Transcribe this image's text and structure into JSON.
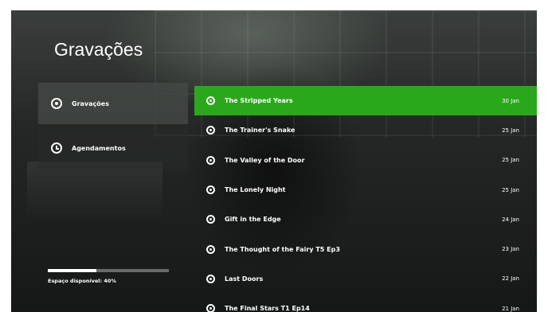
{
  "header": {
    "title": "Gravações"
  },
  "sidebar": {
    "items": [
      {
        "label": "Gravações",
        "icon": "radio-selected-icon",
        "active": true
      },
      {
        "label": "Agendamentos",
        "icon": "clock-icon",
        "active": false
      }
    ]
  },
  "storage": {
    "label": "Espaço disponível: 40%",
    "fraction": 0.4
  },
  "recordings": [
    {
      "title": "The Stripped Years",
      "date": "30 Jan",
      "selected": true
    },
    {
      "title": "The Trainer's Snake",
      "date": "25 Jan"
    },
    {
      "title": "The Valley of the Door",
      "date": "25 Jan"
    },
    {
      "title": "The Lonely Night",
      "date": "25 Jan"
    },
    {
      "title": "Gift in the Edge",
      "date": "24 Jan"
    },
    {
      "title": "The Thought of the Fairy T5 Ep3",
      "date": "23 Jan"
    },
    {
      "title": "Last Doors",
      "date": "22 Jan"
    },
    {
      "title": "The Final Stars T1 Ep14",
      "date": "21 Jan"
    }
  ],
  "colors": {
    "selection": "#2aa81b",
    "text": "#ffffff"
  }
}
